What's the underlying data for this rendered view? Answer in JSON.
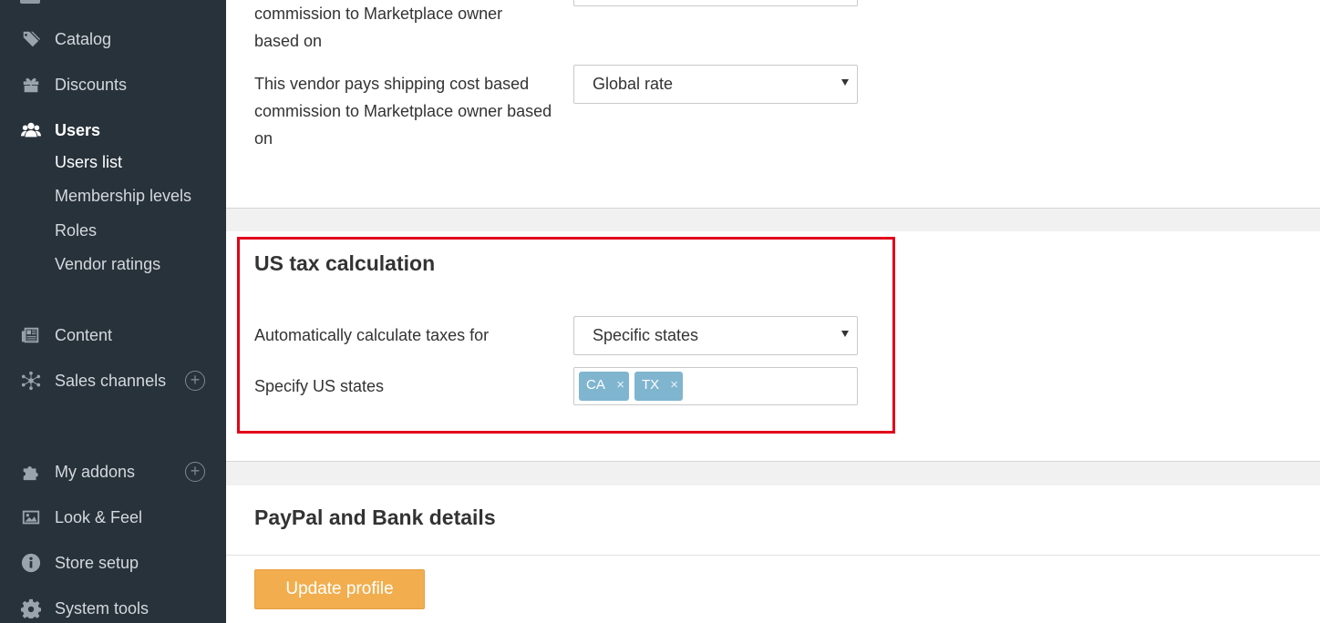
{
  "sidebar": {
    "items": [
      {
        "label": "Catalog",
        "icon": "tags-icon"
      },
      {
        "label": "Discounts",
        "icon": "gift-icon"
      },
      {
        "label": "Users",
        "icon": "users-icon",
        "active": true
      },
      {
        "label": "Content",
        "icon": "newspaper-icon"
      },
      {
        "label": "Sales channels",
        "icon": "network-icon",
        "expandable": true
      },
      {
        "label": "My addons",
        "icon": "puzzle-icon",
        "expandable": true
      },
      {
        "label": "Look & Feel",
        "icon": "image-icon"
      },
      {
        "label": "Store setup",
        "icon": "info-icon"
      },
      {
        "label": "System tools",
        "icon": "gear-icon"
      }
    ],
    "users_submenu": [
      {
        "label": "Users list",
        "current": true
      },
      {
        "label": "Membership levels"
      },
      {
        "label": "Roles"
      },
      {
        "label": "Vendor ratings"
      }
    ],
    "plus_glyph": "+"
  },
  "shipping": {
    "prev_label_tail": "commission to Marketplace owner\nbased on",
    "vendor_pays_label": "This vendor pays shipping cost based commission to Marketplace owner based on",
    "vendor_pays_value": "Global rate"
  },
  "tax": {
    "title": "US tax calculation",
    "auto_label": "Automatically calculate taxes for",
    "auto_value": "Specific states",
    "states_label": "Specify US states",
    "states": [
      "CA",
      "TX"
    ],
    "remove_glyph": "×"
  },
  "paypal": {
    "title": "PayPal and Bank details"
  },
  "actions": {
    "update_label": "Update profile"
  },
  "colors": {
    "sidebar_bg": "#28323a",
    "tag_bg": "#80b5d0",
    "primary_button": "#f2ae4e",
    "highlight": "#e2001a"
  }
}
